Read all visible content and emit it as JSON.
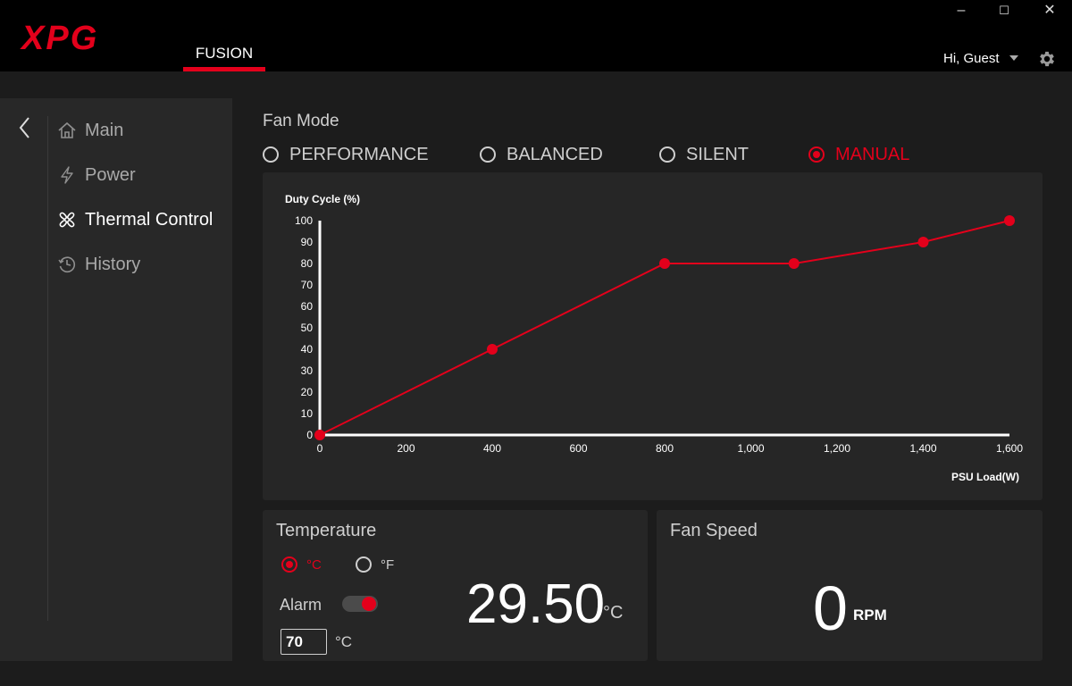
{
  "app": {
    "brand": "XPG",
    "tab": "FUSION",
    "user_greeting": "Hi, Guest",
    "colors": {
      "accent": "#e3001b",
      "background": "#1c1c1c",
      "panel": "#262626",
      "sidebar": "#282828"
    }
  },
  "window_controls": {
    "minimize": "–",
    "maximize": "☐",
    "close": "✕"
  },
  "sidebar": {
    "items": [
      {
        "label": "Main",
        "icon": "home-icon",
        "active": false
      },
      {
        "label": "Power",
        "icon": "lightning-icon",
        "active": false
      },
      {
        "label": "Thermal Control",
        "icon": "fan-icon",
        "active": true
      },
      {
        "label": "History",
        "icon": "clock-icon",
        "active": false
      }
    ]
  },
  "fan_mode": {
    "title": "Fan Mode",
    "options": [
      {
        "label": "PERFORMANCE",
        "selected": false
      },
      {
        "label": "BALANCED",
        "selected": false
      },
      {
        "label": "SILENT",
        "selected": false
      },
      {
        "label": "MANUAL",
        "selected": true
      }
    ]
  },
  "chart_data": {
    "type": "line",
    "ylabel": "Duty Cycle (%)",
    "xlabel": "PSU Load(W)",
    "xlim": [
      0,
      1600
    ],
    "ylim": [
      0,
      100
    ],
    "x_ticks": [
      "0",
      "200",
      "400",
      "600",
      "800",
      "1,000",
      "1,200",
      "1,400",
      "1,600"
    ],
    "y_ticks": [
      "0",
      "10",
      "20",
      "30",
      "40",
      "50",
      "60",
      "70",
      "80",
      "90",
      "100"
    ],
    "series": [
      {
        "x": [
          0,
          400,
          800,
          1100,
          1400,
          1600
        ],
        "y": [
          0,
          40,
          80,
          80,
          90,
          100
        ],
        "color": "#e3001b"
      }
    ],
    "grid": false
  },
  "temperature": {
    "title": "Temperature",
    "unit_c": "°C",
    "unit_f": "°F",
    "selected_unit": "C",
    "alarm_label": "Alarm",
    "alarm_enabled": true,
    "alarm_value": "70",
    "alarm_unit": "°C",
    "value": "29.50",
    "value_unit": "°C"
  },
  "fan_speed": {
    "title": "Fan Speed",
    "value": "0",
    "unit": "RPM"
  }
}
